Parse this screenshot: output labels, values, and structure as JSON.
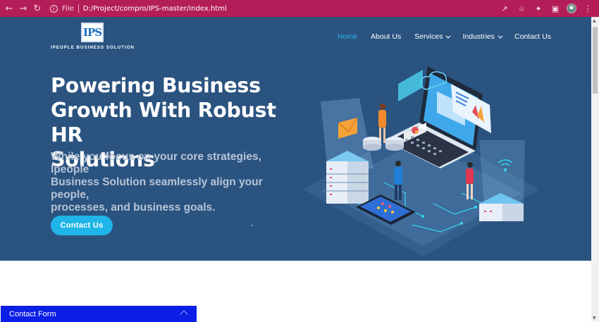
{
  "browser": {
    "file_label": "File",
    "url": "D:/Project/compro/IPS-master/index.html",
    "colors": {
      "chrome": "#b41e58"
    }
  },
  "site": {
    "logo_mark": "IPS",
    "logo_text": "IPEOPLE BUSINESS SOLUTION",
    "nav": [
      {
        "label": "Home",
        "active": true
      },
      {
        "label": "About Us"
      },
      {
        "label": "Services",
        "dropdown": true
      },
      {
        "label": "Industries",
        "dropdown": true
      },
      {
        "label": "Contact Us"
      }
    ],
    "colors": {
      "hero_bg": "#2a5380",
      "accent": "#20b5e8"
    }
  },
  "hero": {
    "headline_lines": [
      "Powering Business",
      "Growth With Robust HR",
      "Solutions"
    ],
    "subline_lines": [
      "While you focus on your core strategies, Ipeople",
      "Business Solution seamlessly align your people,",
      "processes, and business goals."
    ],
    "cta_label": "Contact Us"
  },
  "contact_bar": {
    "label": "Contact Form",
    "color": "#0b1fe6"
  }
}
